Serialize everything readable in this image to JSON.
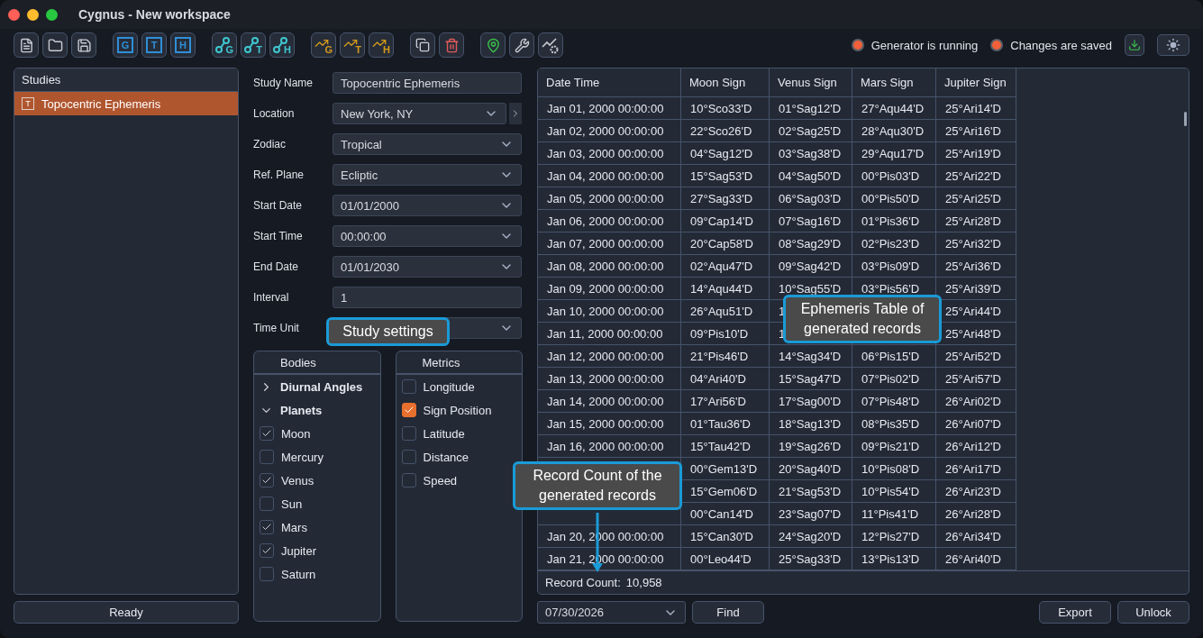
{
  "window": {
    "title": "Cygnus - New workspace"
  },
  "toolbar": [
    [
      {
        "kind": "file"
      },
      {
        "kind": "folder"
      },
      {
        "kind": "save"
      }
    ],
    [
      {
        "kind": "box",
        "letter": "G"
      },
      {
        "kind": "box",
        "letter": "T"
      },
      {
        "kind": "box",
        "letter": "H"
      }
    ],
    [
      {
        "kind": "node",
        "letter": "G"
      },
      {
        "kind": "node",
        "letter": "T"
      },
      {
        "kind": "node",
        "letter": "H"
      }
    ],
    [
      {
        "kind": "trend",
        "letter": "G"
      },
      {
        "kind": "trend",
        "letter": "T"
      },
      {
        "kind": "trend",
        "letter": "H"
      }
    ],
    [
      {
        "kind": "copy"
      },
      {
        "kind": "trash"
      }
    ],
    [
      {
        "kind": "pin"
      },
      {
        "kind": "wrench"
      },
      {
        "kind": "trend-gear"
      }
    ]
  ],
  "status": [
    {
      "label": "Generator is running",
      "on": true
    },
    {
      "label": "Changes are saved",
      "on": true
    }
  ],
  "studies": {
    "title": "Studies",
    "items": [
      {
        "badge": "T",
        "name": "Topocentric Ephemeris",
        "selected": true
      }
    ]
  },
  "ready_button": "Ready",
  "form": [
    {
      "label": "Study Name",
      "kind": "text",
      "value": "Topocentric Ephemeris"
    },
    {
      "label": "Location",
      "kind": "select-nav",
      "value": "New York, NY"
    },
    {
      "label": "Zodiac",
      "kind": "select",
      "value": "Tropical"
    },
    {
      "label": "Ref. Plane",
      "kind": "select",
      "value": "Ecliptic"
    },
    {
      "label": "Start Date",
      "kind": "select",
      "value": "01/01/2000"
    },
    {
      "label": "Start Time",
      "kind": "select",
      "value": "00:00:00"
    },
    {
      "label": "End Date",
      "kind": "select",
      "value": "01/01/2030"
    },
    {
      "label": "Interval",
      "kind": "text",
      "value": "1"
    },
    {
      "label": "Time Unit",
      "kind": "select"
    }
  ],
  "bodies": {
    "title": "Bodies",
    "items": [
      {
        "label": "Diurnal Angles",
        "expanded": false
      },
      {
        "label": "Planets",
        "expanded": true,
        "children": [
          {
            "label": "Moon",
            "checked": true
          },
          {
            "label": "Mercury",
            "checked": false
          },
          {
            "label": "Venus",
            "checked": true
          },
          {
            "label": "Sun",
            "checked": false
          },
          {
            "label": "Mars",
            "checked": true
          },
          {
            "label": "Jupiter",
            "checked": true
          },
          {
            "label": "Saturn",
            "checked": false
          }
        ]
      }
    ]
  },
  "metrics": {
    "title": "Metrics",
    "items": [
      {
        "label": "Longitude",
        "checked": false
      },
      {
        "label": "Sign Position",
        "checked": true
      },
      {
        "label": "Latitude",
        "checked": false
      },
      {
        "label": "Distance",
        "checked": false
      },
      {
        "label": "Speed",
        "checked": false
      }
    ]
  },
  "table": {
    "columns": [
      "Date Time",
      "Moon Sign",
      "Venus Sign",
      "Mars Sign",
      "Jupiter Sign"
    ],
    "rows": [
      [
        "Jan 01, 2000 00:00:00",
        "10°Sco33'D",
        "01°Sag12'D",
        "27°Aqu44'D",
        "25°Ari14'D"
      ],
      [
        "Jan 02, 2000 00:00:00",
        "22°Sco26'D",
        "02°Sag25'D",
        "28°Aqu30'D",
        "25°Ari16'D"
      ],
      [
        "Jan 03, 2000 00:00:00",
        "04°Sag12'D",
        "03°Sag38'D",
        "29°Aqu17'D",
        "25°Ari19'D"
      ],
      [
        "Jan 04, 2000 00:00:00",
        "15°Sag53'D",
        "04°Sag50'D",
        "00°Pis03'D",
        "25°Ari22'D"
      ],
      [
        "Jan 05, 2000 00:00:00",
        "27°Sag33'D",
        "06°Sag03'D",
        "00°Pis50'D",
        "25°Ari25'D"
      ],
      [
        "Jan 06, 2000 00:00:00",
        "09°Cap14'D",
        "07°Sag16'D",
        "01°Pis36'D",
        "25°Ari28'D"
      ],
      [
        "Jan 07, 2000 00:00:00",
        "20°Cap58'D",
        "08°Sag29'D",
        "02°Pis23'D",
        "25°Ari32'D"
      ],
      [
        "Jan 08, 2000 00:00:00",
        "02°Aqu47'D",
        "09°Sag42'D",
        "03°Pis09'D",
        "25°Ari36'D"
      ],
      [
        "Jan 09, 2000 00:00:00",
        "14°Aqu44'D",
        "10°Sag55'D",
        "03°Pis56'D",
        "25°Ari39'D"
      ],
      [
        "Jan 10, 2000 00:00:00",
        "26°Aqu51'D",
        "1",
        null,
        "25°Ari44'D"
      ],
      [
        "Jan 11, 2000 00:00:00",
        "09°Pis10'D",
        "1",
        null,
        "25°Ari48'D"
      ],
      [
        "Jan 12, 2000 00:00:00",
        "21°Pis46'D",
        "14°Sag34'D",
        "06°Pis15'D",
        "25°Ari52'D"
      ],
      [
        "Jan 13, 2000 00:00:00",
        "04°Ari40'D",
        "15°Sag47'D",
        "07°Pis02'D",
        "25°Ari57'D"
      ],
      [
        "Jan 14, 2000 00:00:00",
        "17°Ari56'D",
        "17°Sag00'D",
        "07°Pis48'D",
        "26°Ari02'D"
      ],
      [
        "Jan 15, 2000 00:00:00",
        "01°Tau36'D",
        "18°Sag13'D",
        "08°Pis35'D",
        "26°Ari07'D"
      ],
      [
        "Jan 16, 2000 00:00:00",
        "15°Tau42'D",
        "19°Sag26'D",
        "09°Pis21'D",
        "26°Ari12'D"
      ],
      [
        null,
        "00°Gem13'D",
        "20°Sag40'D",
        "10°Pis08'D",
        "26°Ari17'D"
      ],
      [
        null,
        "15°Gem06'D",
        "21°Sag53'D",
        "10°Pis54'D",
        "26°Ari23'D"
      ],
      [
        null,
        "00°Can14'D",
        "23°Sag07'D",
        "11°Pis41'D",
        "26°Ari28'D"
      ],
      [
        "Jan 20, 2000 00:00:00",
        "15°Can30'D",
        "24°Sag20'D",
        "12°Pis27'D",
        "26°Ari34'D"
      ],
      [
        "Jan 21, 2000 00:00:00",
        "00°Leo44'D",
        "25°Sag33'D",
        "13°Pis13'D",
        "26°Ari40'D"
      ]
    ]
  },
  "record_count": {
    "label": "Record Count:",
    "value": "10,958"
  },
  "find_date": "07/30/2026",
  "find_button": "Find",
  "export_button": "Export",
  "unlock_button": "Unlock",
  "callouts": [
    {
      "kind": "plain",
      "text": "Study settings"
    },
    {
      "kind": "plain",
      "text": "Ephemeris Table of generated records"
    },
    {
      "kind": "arrow",
      "text": "Record Count of the generated records"
    }
  ]
}
